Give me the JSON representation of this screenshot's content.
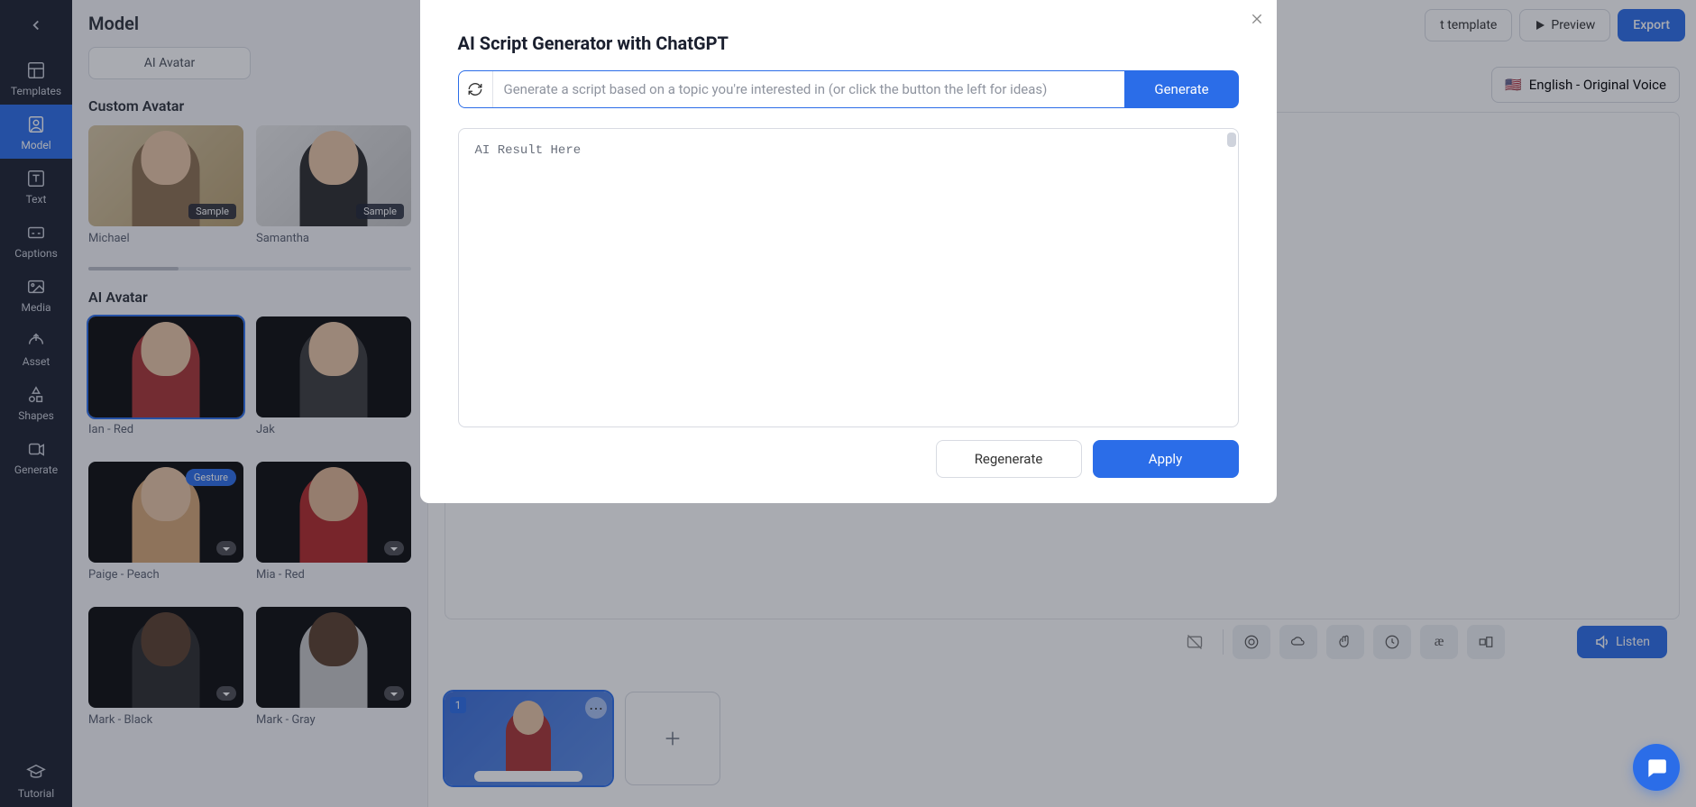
{
  "leftnav": {
    "items": [
      {
        "label": "Templates"
      },
      {
        "label": "Model"
      },
      {
        "label": "Text"
      },
      {
        "label": "Captions"
      },
      {
        "label": "Media"
      },
      {
        "label": "Asset"
      },
      {
        "label": "Shapes"
      },
      {
        "label": "Generate"
      }
    ],
    "bottom": {
      "label": "Tutorial"
    }
  },
  "panel": {
    "title": "Model",
    "tab": "AI Avatar",
    "custom_title": "Custom Avatar",
    "ai_title": "AI Avatar",
    "sample_badge": "Sample",
    "gesture_badge": "Gesture",
    "custom": [
      {
        "label": "Michael"
      },
      {
        "label": "Samantha"
      }
    ],
    "ai": [
      {
        "label": "Ian - Red"
      },
      {
        "label": "Jak"
      },
      {
        "label": "Paige - Peach"
      },
      {
        "label": "Mia - Red"
      },
      {
        "label": "Mark - Black"
      },
      {
        "label": "Mark - Gray"
      }
    ]
  },
  "top": {
    "template_btn": "t template",
    "preview_btn": "Preview",
    "export_btn": "Export"
  },
  "lang": {
    "label": "English - Original Voice",
    "flag": "🇺🇸"
  },
  "toolbar": {
    "listen": "Listen"
  },
  "scene": {
    "num": "1"
  },
  "modal": {
    "title": "AI Script Generator with ChatGPT",
    "placeholder": "Generate a script based on a topic you're interested in (or click the button the left for ideas)",
    "generate": "Generate",
    "result_placeholder": "AI Result Here",
    "regenerate": "Regenerate",
    "apply": "Apply"
  }
}
